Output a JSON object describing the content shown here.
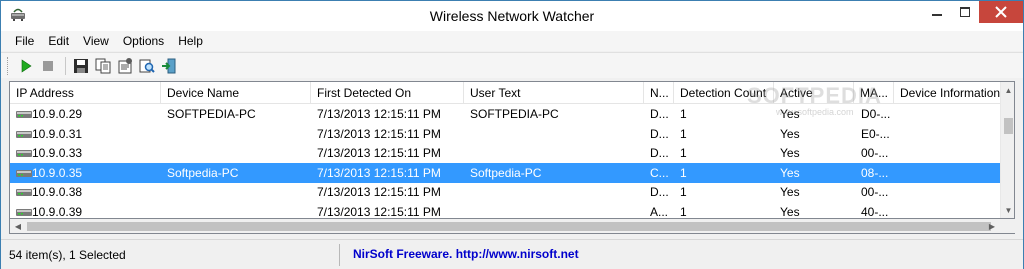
{
  "window": {
    "title": "Wireless Network Watcher"
  },
  "menu": {
    "items": [
      "File",
      "Edit",
      "View",
      "Options",
      "Help"
    ]
  },
  "toolbar": {
    "buttons": [
      "start-scan-icon",
      "stop-scan-icon",
      "save-icon",
      "copy-icon",
      "properties-icon",
      "find-icon",
      "exit-icon"
    ]
  },
  "table": {
    "columns": [
      "IP Address",
      "Device Name",
      "First Detected On",
      "User Text",
      "N...",
      "Detection Count",
      "Active",
      "MA...",
      "Device Information"
    ],
    "rows": [
      {
        "ip": "10.9.0.29",
        "device": "SOFTPEDIA-PC",
        "first": "7/13/2013 12:15:11 PM",
        "user": "SOFTPEDIA-PC",
        "n": "D...",
        "count": "1",
        "active": "Yes",
        "mac": "D0-...",
        "info": "",
        "selected": false
      },
      {
        "ip": "10.9.0.31",
        "device": "",
        "first": "7/13/2013 12:15:11 PM",
        "user": "",
        "n": "D...",
        "count": "1",
        "active": "Yes",
        "mac": "E0-...",
        "info": "",
        "selected": false
      },
      {
        "ip": "10.9.0.33",
        "device": "",
        "first": "7/13/2013 12:15:11 PM",
        "user": "",
        "n": "D...",
        "count": "1",
        "active": "Yes",
        "mac": "00-...",
        "info": "",
        "selected": false
      },
      {
        "ip": "10.9.0.35",
        "device": "Softpedia-PC",
        "first": "7/13/2013 12:15:11 PM",
        "user": "Softpedia-PC",
        "n": "C...",
        "count": "1",
        "active": "Yes",
        "mac": "08-...",
        "info": "",
        "selected": true
      },
      {
        "ip": "10.9.0.38",
        "device": "",
        "first": "7/13/2013 12:15:11 PM",
        "user": "",
        "n": "D...",
        "count": "1",
        "active": "Yes",
        "mac": "00-...",
        "info": "",
        "selected": false
      },
      {
        "ip": "10.9.0.39",
        "device": "",
        "first": "7/13/2013 12:15:11 PM",
        "user": "",
        "n": "A...",
        "count": "1",
        "active": "Yes",
        "mac": "40-...",
        "info": "",
        "selected": false
      }
    ]
  },
  "watermark": {
    "text": "SOFTPEDIA",
    "sub": "www.softpedia.com"
  },
  "status": {
    "items": "54 item(s), 1 Selected",
    "link": "NirSoft Freeware.  http://www.nirsoft.net"
  },
  "colors": {
    "selection": "#3399ff",
    "close_button": "#c7463c",
    "link": "#0000cc"
  }
}
